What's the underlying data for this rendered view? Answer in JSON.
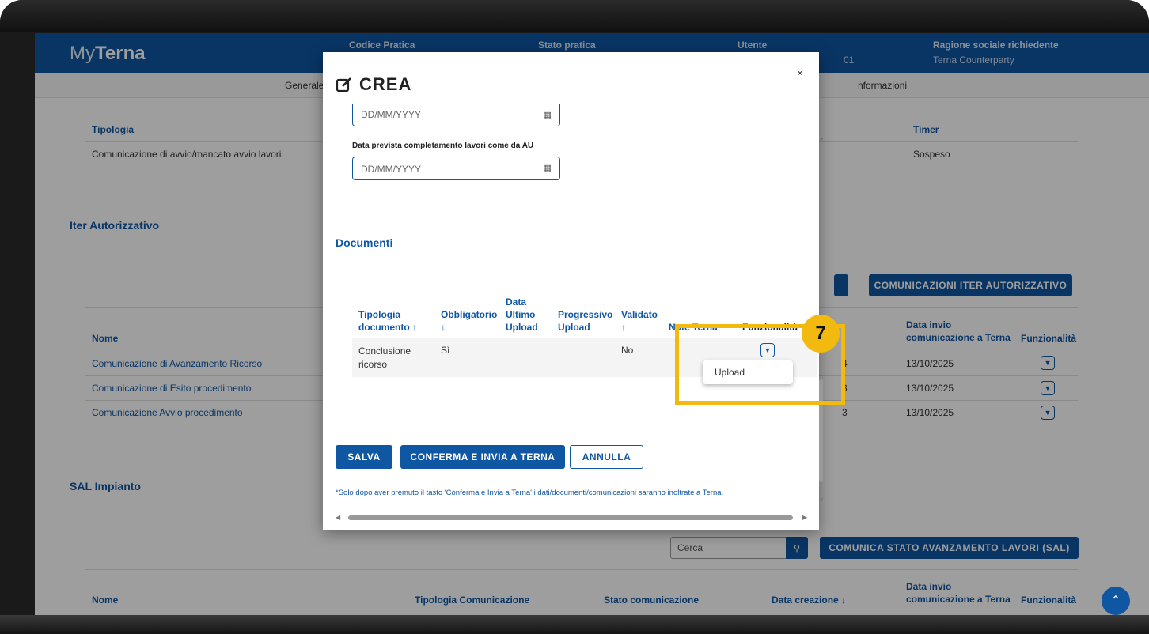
{
  "header": {
    "logo_light": "My",
    "logo_bold": "Terna",
    "col1": "Codice Pratica",
    "col2": "Stato pratica",
    "col3": "Utente",
    "col3_val": "01",
    "col4": "Ragione sociale richiedente",
    "col4_val": "Terna Counterparty"
  },
  "nav": {
    "left": "Generale",
    "right": "nformazioni"
  },
  "top_table": {
    "h1": "Tipologia",
    "h2": "Timer",
    "v1": "Comunicazione di avvio/mancato avvio lavori",
    "v2": "Sospeso"
  },
  "iter": {
    "title": "Iter Autorizzativo",
    "button": "COMUNICAZIONI ITER AUTORIZZATIVO",
    "col_nome": "Nome",
    "col_data": "Data invio comunicazione a Terna",
    "col_funz": "Funzionalità",
    "rows": [
      {
        "nome": "Comunicazione di Avanzamento Ricorso",
        "frag": "4",
        "data": "13/10/2025"
      },
      {
        "nome": "Comunicazione di Esito procedimento",
        "frag": "3",
        "data": "13/10/2025"
      },
      {
        "nome": "Comunicazione Avvio procedimento",
        "frag": "3",
        "data": "13/10/2025"
      }
    ]
  },
  "sal": {
    "title": "SAL Impianto",
    "search_placeholder": "Cerca",
    "button": "COMUNICA STATO AVANZAMENTO LAVORI (SAL)",
    "col_nome": "Nome",
    "col_tipologia": "Tipologia Comunicazione",
    "col_stato": "Stato comunicazione",
    "col_creazione": "Data creazione",
    "col_data": "Data invio comunicazione a Terna",
    "col_funz": "Funzionalità"
  },
  "modal": {
    "title": "CREA",
    "close": "×",
    "date_placeholder_1": "DD/MM/YYYY",
    "date_label_2": "Data prevista completamento lavori come da AU",
    "date_placeholder_2": "DD/MM/YYYY",
    "documenti_title": "Documenti",
    "cols": {
      "tipologia": "Tipologia documento",
      "obbligatorio": "Obbligatorio",
      "data_ultimo": "Data Ultimo Upload",
      "progressivo": "Progressivo Upload",
      "validato": "Validato",
      "note": "Note Terna",
      "funzionalita": "Funzionalità"
    },
    "row": {
      "tipologia": "Conclusione ricorso",
      "obbligatorio": "Sì",
      "data_ultimo": "",
      "progressivo": "",
      "validato": "No",
      "note": ""
    },
    "dropdown_item": "Upload",
    "btn_salva": "SALVA",
    "btn_conferma": "CONFERMA E INVIA A TERNA",
    "btn_annulla": "ANNULLA",
    "footnote": "*Solo dopo aver premuto il tasto 'Conferma e Invia a Terna' i dati/documenti/comunicazioni saranno inoltrate a Terna."
  },
  "callout": {
    "number": "7"
  },
  "colors": {
    "brand": "#0f56a3",
    "highlight": "#f2b90f"
  }
}
